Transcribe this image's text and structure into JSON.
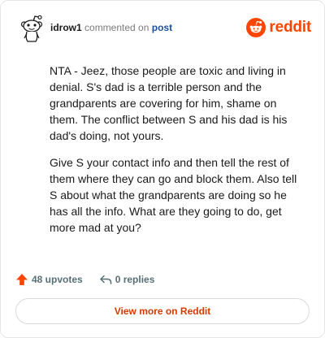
{
  "header": {
    "username": "idrow1",
    "action_text": "commented on",
    "post_link": "post",
    "brand": "reddit"
  },
  "comment": {
    "paragraphs": [
      "NTA - Jeez, those people are toxic and living in denial. S's dad is a terrible person and the grandparents are covering for him, shame on them. The conflict between S and his dad is his dad's doing, not yours.",
      "Give S your contact info and then tell the rest of them where they can go and block them. Also tell S about what the grandparents are doing so he has all the info. What are they going to do, get more mad at you?"
    ]
  },
  "footer": {
    "upvotes_label": "48 upvotes",
    "replies_label": "0 replies"
  },
  "view_more_label": "View more on Reddit",
  "icons": {
    "avatar": "snoo-avatar-icon",
    "brand": "reddit-logo-icon",
    "upvote": "upvote-arrow-icon",
    "reply": "reply-arrow-icon"
  },
  "colors": {
    "brand": "#ff4500",
    "upvote": "#ff4500",
    "link": "#1a4fa0",
    "view_more_text": "#d93900",
    "muted": "#576f76"
  }
}
